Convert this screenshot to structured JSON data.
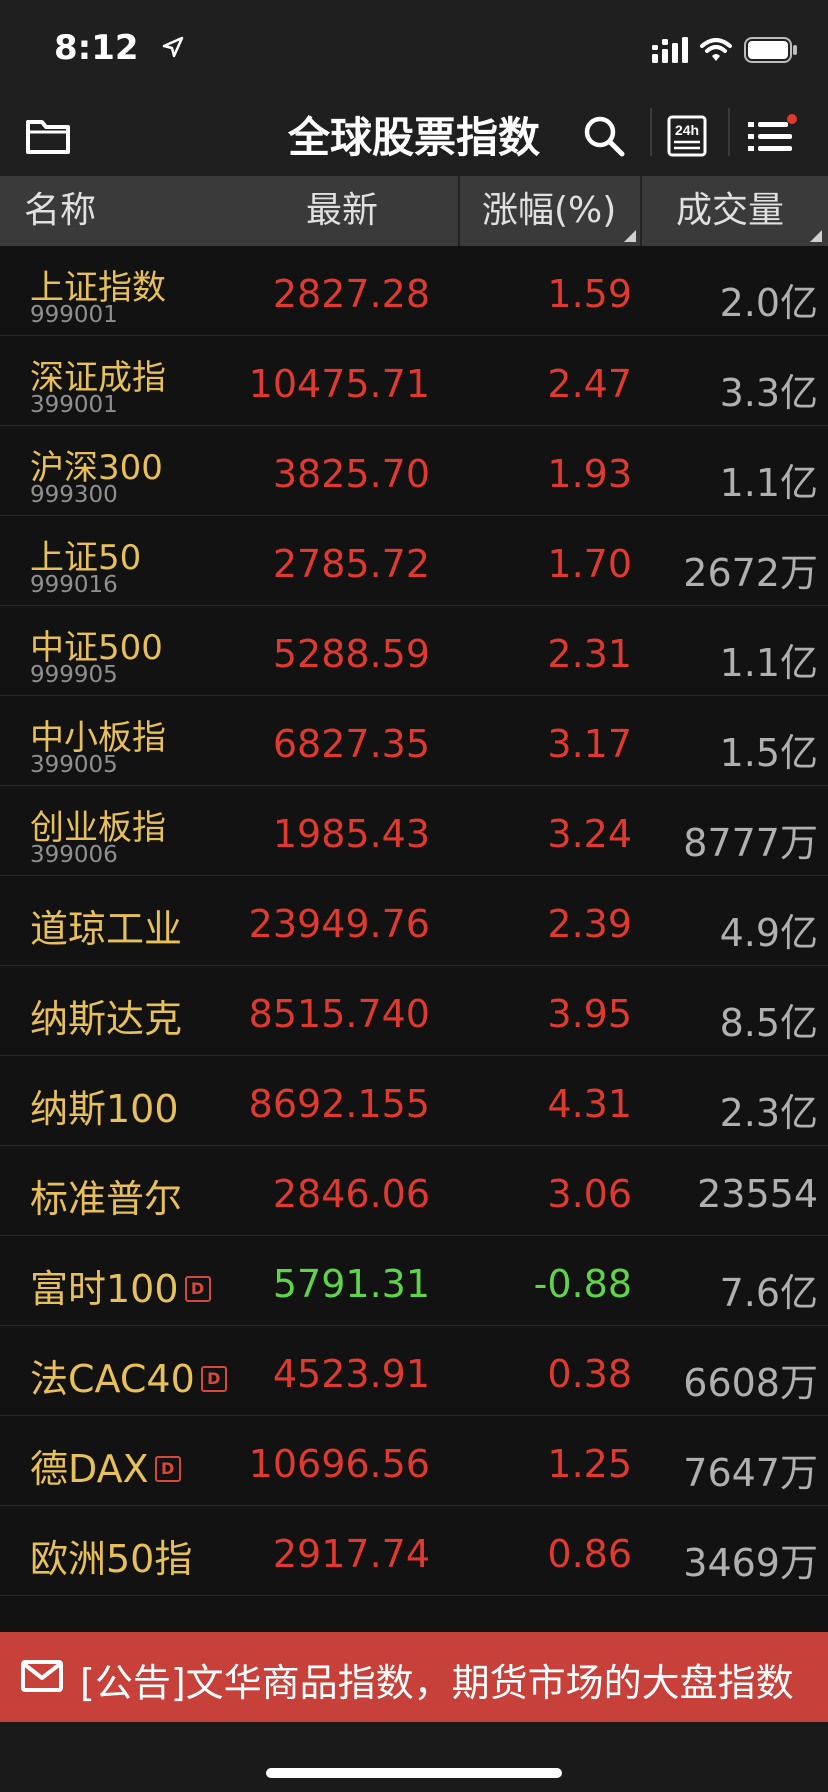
{
  "status": {
    "time": "8:12"
  },
  "nav": {
    "title": "全球股票指数"
  },
  "header": {
    "name": "名称",
    "latest": "最新",
    "change": "涨幅(%)",
    "volume": "成交量"
  },
  "rows": [
    {
      "name": "上证指数",
      "code": "999001",
      "latest": "2827.28",
      "change": "1.59",
      "volume": "2.0亿",
      "trend": "up"
    },
    {
      "name": "深证成指",
      "code": "399001",
      "latest": "10475.71",
      "change": "2.47",
      "volume": "3.3亿",
      "trend": "up"
    },
    {
      "name": "沪深300",
      "code": "999300",
      "latest": "3825.70",
      "change": "1.93",
      "volume": "1.1亿",
      "trend": "up"
    },
    {
      "name": "上证50",
      "code": "999016",
      "latest": "2785.72",
      "change": "1.70",
      "volume": "2672万",
      "trend": "up"
    },
    {
      "name": "中证500",
      "code": "999905",
      "latest": "5288.59",
      "change": "2.31",
      "volume": "1.1亿",
      "trend": "up"
    },
    {
      "name": "中小板指",
      "code": "399005",
      "latest": "6827.35",
      "change": "3.17",
      "volume": "1.5亿",
      "trend": "up"
    },
    {
      "name": "创业板指",
      "code": "399006",
      "latest": "1985.43",
      "change": "3.24",
      "volume": "8777万",
      "trend": "up"
    },
    {
      "name": "道琼工业",
      "code": "",
      "latest": "23949.76",
      "change": "2.39",
      "volume": "4.9亿",
      "trend": "up"
    },
    {
      "name": "纳斯达克",
      "code": "",
      "latest": "8515.740",
      "change": "3.95",
      "volume": "8.5亿",
      "trend": "up"
    },
    {
      "name": "纳斯100",
      "code": "",
      "latest": "8692.155",
      "change": "4.31",
      "volume": "2.3亿",
      "trend": "up"
    },
    {
      "name": "标准普尔",
      "code": "",
      "latest": "2846.06",
      "change": "3.06",
      "volume": "23554",
      "trend": "up"
    },
    {
      "name": "富时100",
      "code": "",
      "badge": "D",
      "latest": "5791.31",
      "change": "-0.88",
      "volume": "7.6亿",
      "trend": "down"
    },
    {
      "name": "法CAC40",
      "code": "",
      "badge": "D",
      "latest": "4523.91",
      "change": "0.38",
      "volume": "6608万",
      "trend": "up"
    },
    {
      "name": "德DAX",
      "code": "",
      "badge": "D",
      "latest": "10696.56",
      "change": "1.25",
      "volume": "7647万",
      "trend": "up"
    },
    {
      "name": "欧洲50指",
      "code": "",
      "latest": "2917.74",
      "change": "0.86",
      "volume": "3469万",
      "trend": "up"
    }
  ],
  "banner": {
    "text": "[公告]文华商品指数，期货市场的大盘指数"
  },
  "colors": {
    "up": "#e0392f",
    "down": "#5fd44a",
    "name": "#e8c05a",
    "banner": "#c8403a"
  },
  "icons": [
    "folder-icon",
    "search-icon",
    "24h-icon",
    "menu-list-icon",
    "mail-icon",
    "signal-icon",
    "wifi-icon",
    "battery-icon",
    "location-arrow-icon"
  ]
}
